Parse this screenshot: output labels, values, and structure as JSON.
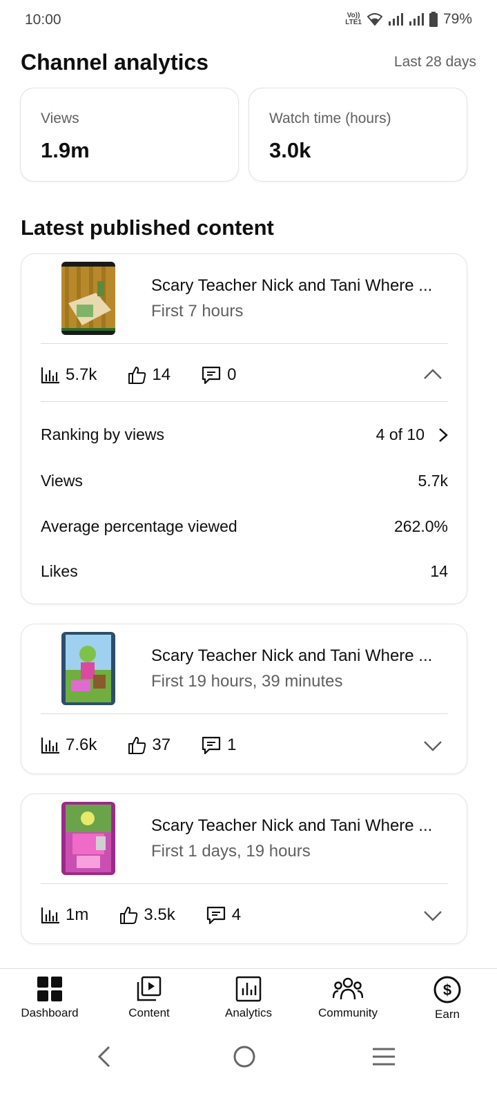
{
  "status_bar": {
    "time": "10:00",
    "network_label": "VoLTE1",
    "battery": "79%"
  },
  "header": {
    "title": "Channel analytics",
    "range": "Last 28 days"
  },
  "stats": [
    {
      "label": "Views",
      "value": "1.9m"
    },
    {
      "label": "Watch time (hours)",
      "value": "3.0k"
    }
  ],
  "section_title": "Latest published content",
  "videos": [
    {
      "title": "Scary Teacher Nick and Tani Where ...",
      "subtitle": "First 7 hours",
      "views": "5.7k",
      "likes": "14",
      "comments": "0",
      "expanded": true,
      "details": {
        "ranking_label": "Ranking by views",
        "ranking_value": "4 of 10",
        "views_label": "Views",
        "views_value": "5.7k",
        "avg_label": "Average percentage viewed",
        "avg_value": "262.0%",
        "likes_label": "Likes",
        "likes_value": "14"
      }
    },
    {
      "title": "Scary Teacher Nick and Tani Where ...",
      "subtitle": "First 19 hours, 39 minutes",
      "views": "7.6k",
      "likes": "37",
      "comments": "1",
      "expanded": false
    },
    {
      "title": "Scary Teacher Nick and Tani Where ...",
      "subtitle": "First 1 days, 19 hours",
      "views": "1m",
      "likes": "3.5k",
      "comments": "4",
      "expanded": false
    }
  ],
  "bottom_nav": [
    {
      "label": "Dashboard",
      "icon": "dashboard-icon"
    },
    {
      "label": "Content",
      "icon": "content-icon"
    },
    {
      "label": "Analytics",
      "icon": "analytics-icon"
    },
    {
      "label": "Community",
      "icon": "community-icon"
    },
    {
      "label": "Earn",
      "icon": "earn-icon"
    }
  ],
  "system_nav": {
    "icons": [
      "back-icon",
      "home-icon",
      "recents-icon"
    ]
  }
}
